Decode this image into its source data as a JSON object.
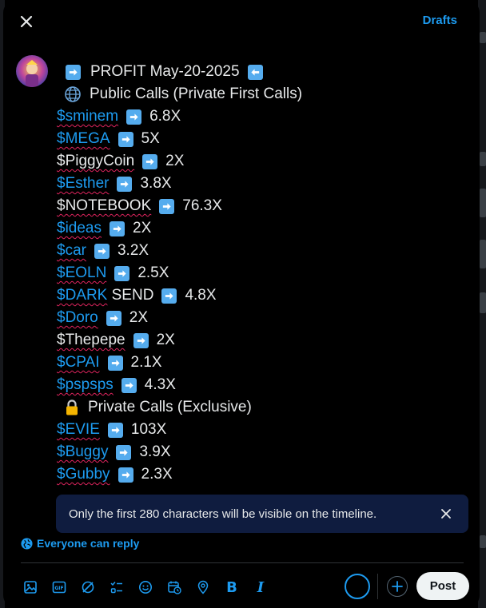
{
  "header": {
    "drafts_label": "Drafts"
  },
  "post": {
    "title_line": {
      "text": "PROFIT May-20-2025"
    },
    "public_header": "Public Calls (Private First Calls)",
    "private_header": "Private Calls (Exclusive)",
    "public_calls": [
      {
        "ticker": "$sminem",
        "linked": true,
        "result": "6.8X"
      },
      {
        "ticker": "$MEGA",
        "linked": true,
        "result": "5X"
      },
      {
        "ticker": "$PiggyCoin",
        "linked": false,
        "result": "2X"
      },
      {
        "ticker": "$Esther",
        "linked": true,
        "result": "3.8X"
      },
      {
        "ticker": "$NOTEBOOK",
        "linked": false,
        "result": "76.3X"
      },
      {
        "ticker": "$ideas",
        "linked": true,
        "result": "2X"
      },
      {
        "ticker": "$car",
        "linked": true,
        "result": "3.2X"
      },
      {
        "ticker": "$EOLN",
        "linked": true,
        "result": "2.5X"
      },
      {
        "ticker": "$DARK",
        "suffix": " SEND",
        "linked": true,
        "result": "4.8X"
      },
      {
        "ticker": "$Doro",
        "linked": true,
        "result": "2X"
      },
      {
        "ticker": "$Thepepe",
        "linked": false,
        "result": "2X"
      },
      {
        "ticker": "$CPAI",
        "linked": true,
        "result": "2.1X"
      },
      {
        "ticker": "$pspsps",
        "linked": true,
        "result": "4.3X"
      }
    ],
    "private_calls": [
      {
        "ticker": "$EVIE",
        "linked": true,
        "result": "103X"
      },
      {
        "ticker": "$Buggy",
        "linked": true,
        "result": "3.9X"
      },
      {
        "ticker": "$Gubby",
        "linked": true,
        "result": "2.3X"
      }
    ]
  },
  "notice": {
    "text": "Only the first 280 characters will be visible on the timeline."
  },
  "reply_setting": "Everyone can reply",
  "toolbar": {
    "icons": [
      "image-icon",
      "gif-icon",
      "grok-icon",
      "poll-icon",
      "emoji-icon",
      "schedule-icon",
      "location-icon",
      "bold-icon",
      "italic-icon"
    ],
    "bold_label": "B",
    "italic_label": "I",
    "post_label": "Post"
  },
  "colors": {
    "accent": "#1d9bf0",
    "notice_bg": "#0f1c3f",
    "spell_underline": "#e0245e",
    "arrow_emoji": "#55acee"
  }
}
